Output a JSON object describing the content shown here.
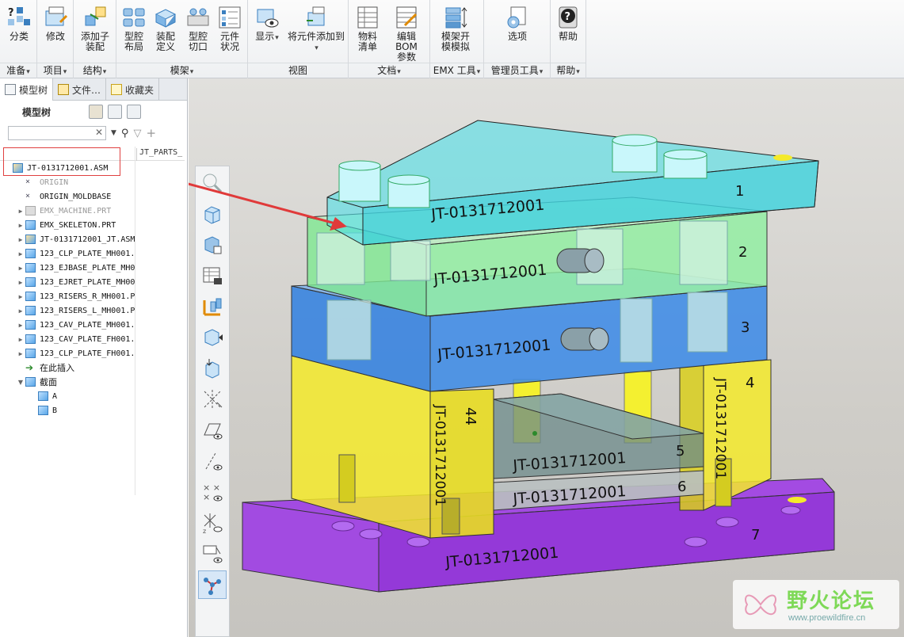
{
  "colors": {
    "plate1": "#4fe0e8",
    "plate2": "#7ee891",
    "plate3": "#2f7fe0",
    "plate4": "#f4ea2a",
    "plate5": "#6b8a8a",
    "plate7": "#9b35e6",
    "annotation": "#e03a3a",
    "accent": "#3a7fbf"
  },
  "ribbon": {
    "groups": [
      {
        "footer": "准备",
        "buttons": [
          {
            "label": "分类",
            "icon": "question-category-icon"
          }
        ]
      },
      {
        "footer": "项目",
        "buttons": [
          {
            "label": "修改",
            "icon": "modify-icon"
          }
        ]
      },
      {
        "footer": "结构",
        "buttons": [
          {
            "label": "添加子\n装配",
            "icon": "add-subassembly-icon"
          }
        ]
      },
      {
        "footer": "模架",
        "buttons": [
          {
            "label": "型腔\n布局",
            "icon": "cavity-layout-icon"
          },
          {
            "label": "装配\n定义",
            "icon": "assembly-define-icon"
          },
          {
            "label": "型腔\n切口",
            "icon": "cavity-cut-icon"
          },
          {
            "label": "元件\n状况",
            "icon": "component-status-icon"
          }
        ]
      },
      {
        "footer": "视图",
        "buttons": [
          {
            "label": "显示",
            "icon": "display-icon"
          },
          {
            "label": "将元件添加到",
            "icon": "add-component-to-icon"
          }
        ]
      },
      {
        "footer": "文档",
        "buttons": [
          {
            "label": "物料\n清单",
            "icon": "bom-list-icon"
          },
          {
            "label": "编辑 BOM\n参数",
            "icon": "edit-bom-params-icon"
          }
        ]
      },
      {
        "footer": "EMX 工具",
        "buttons": [
          {
            "label": "模架开\n模模拟",
            "icon": "mold-open-sim-icon"
          }
        ]
      },
      {
        "footer": "管理员工具",
        "buttons": [
          {
            "label": "选项",
            "icon": "options-icon"
          }
        ]
      },
      {
        "footer": "帮助",
        "buttons": [
          {
            "label": "帮助",
            "icon": "help-icon"
          }
        ]
      }
    ]
  },
  "panel": {
    "tabs": [
      "模型树",
      "文件…",
      "收藏夹"
    ],
    "title": "模型树",
    "search_placeholder": "",
    "column_header": "JT_PARTS_",
    "tree": [
      {
        "label": "JT-0131712001.ASM",
        "icon": "asm",
        "expand": "",
        "indent": 0
      },
      {
        "label": "ORIGIN",
        "icon": "csys",
        "expand": "",
        "indent": 1,
        "faded": true
      },
      {
        "label": "ORIGIN_MOLDBASE",
        "icon": "csys",
        "expand": "",
        "indent": 1
      },
      {
        "label": "EMX_MACHINE.PRT",
        "icon": "grey",
        "expand": "▶",
        "indent": 1,
        "faded": true
      },
      {
        "label": "EMX_SKELETON.PRT",
        "icon": "part",
        "expand": "▶",
        "indent": 1
      },
      {
        "label": "JT-0131712001_JT.ASM",
        "icon": "asm",
        "expand": "▶",
        "indent": 1
      },
      {
        "label": "123_CLP_PLATE_MH001.",
        "icon": "part",
        "expand": "▶",
        "indent": 1
      },
      {
        "label": "123_EJBASE_PLATE_MH0",
        "icon": "part",
        "expand": "▶",
        "indent": 1
      },
      {
        "label": "123_EJRET_PLATE_MH00",
        "icon": "part",
        "expand": "▶",
        "indent": 1
      },
      {
        "label": "123_RISERS_R_MH001.P",
        "icon": "part",
        "expand": "▶",
        "indent": 1
      },
      {
        "label": "123_RISERS_L_MH001.P",
        "icon": "part",
        "expand": "▶",
        "indent": 1
      },
      {
        "label": "123_CAV_PLATE_MH001.",
        "icon": "part",
        "expand": "▶",
        "indent": 1
      },
      {
        "label": "123_CAV_PLATE_FH001.",
        "icon": "part",
        "expand": "▶",
        "indent": 1
      },
      {
        "label": "123_CLP_PLATE_FH001.",
        "icon": "part",
        "expand": "▶",
        "indent": 1
      },
      {
        "label": "在此插入",
        "icon": "arr",
        "expand": "",
        "indent": 1,
        "cn": true
      },
      {
        "label": "截面",
        "icon": "part",
        "expand": "▼",
        "indent": 1,
        "cn": true
      },
      {
        "label": "A",
        "icon": "part",
        "expand": "",
        "indent": 2
      },
      {
        "label": "B",
        "icon": "part",
        "expand": "",
        "indent": 2
      }
    ]
  },
  "model": {
    "part_name": "JT-0131712001",
    "plate_numbers": [
      "1",
      "2",
      "3",
      "4",
      "44",
      "5",
      "6",
      "7"
    ]
  },
  "watermark": {
    "title": "野火论坛",
    "url": "www.proewildfire.cn"
  }
}
